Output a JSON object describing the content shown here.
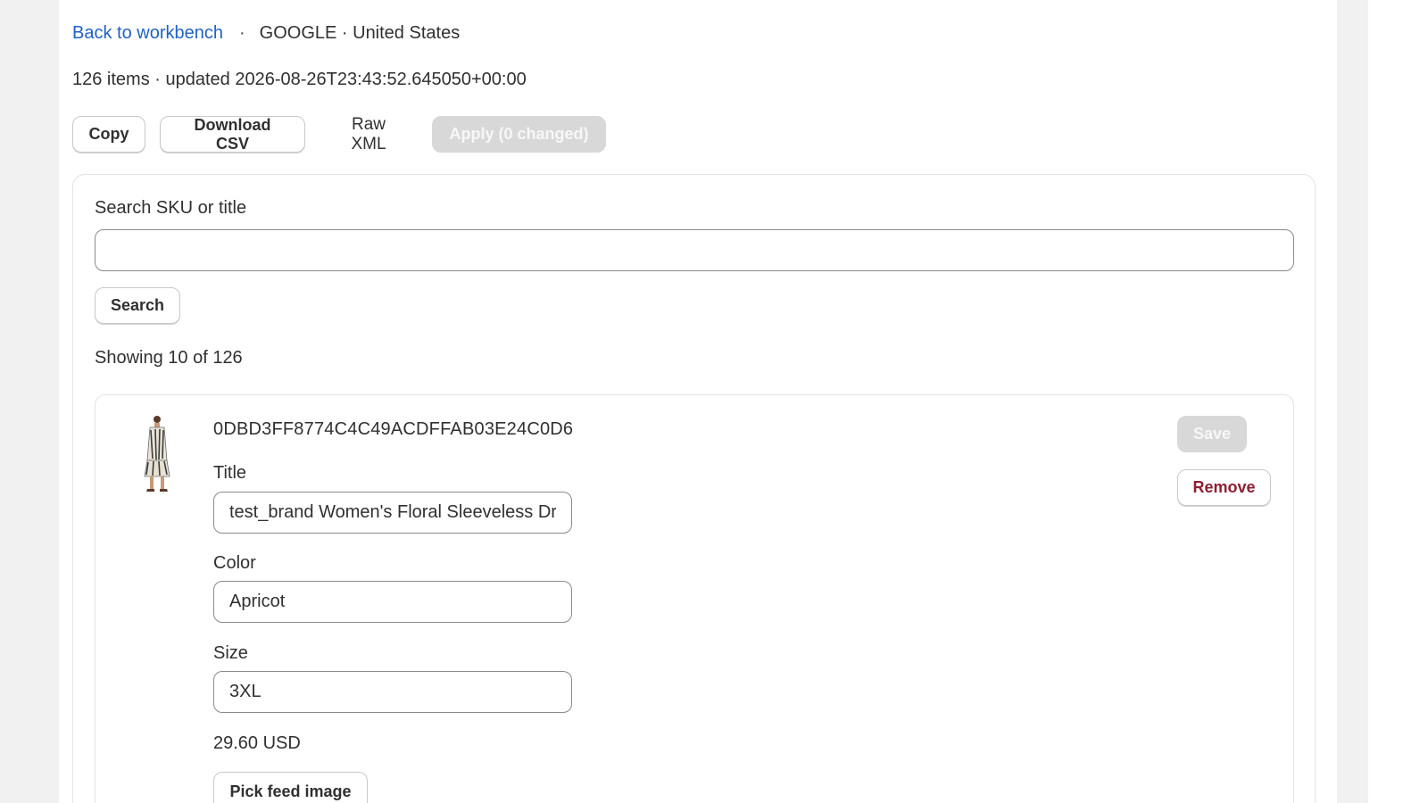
{
  "header": {
    "back_link": "Back to workbench",
    "separator": "·",
    "context": "GOOGLE · United States"
  },
  "summary": {
    "text": "126 items · updated 2026-08-26T23:43:52.645050+00:00"
  },
  "toolbar": {
    "copy_label": "Copy",
    "download_csv_label": "Download CSV",
    "raw_xml_label": "Raw XML",
    "apply_label": "Apply (0 changed)"
  },
  "search": {
    "label": "Search SKU or title",
    "value": "",
    "button_label": "Search"
  },
  "results": {
    "showing_text": "Showing 10 of 126"
  },
  "items": [
    {
      "sku": "0DBD3FF8774C4C49ACDFFAB03E24C0D6",
      "title_label": "Title",
      "title_value": "test_brand Women's Floral Sleeveless Dress",
      "color_label": "Color",
      "color_value": "Apricot",
      "size_label": "Size",
      "size_value": "3XL",
      "price": "29.60 USD",
      "pick_image_label": "Pick feed image",
      "save_label": "Save",
      "remove_label": "Remove"
    }
  ],
  "colors": {
    "link": "#1f62c4",
    "danger": "#8e1f33",
    "disabled_bg": "#d8d8d8",
    "page_bg": "#f1f1f1"
  },
  "icons": {
    "thumbnail": "product-dress-thumbnail"
  }
}
